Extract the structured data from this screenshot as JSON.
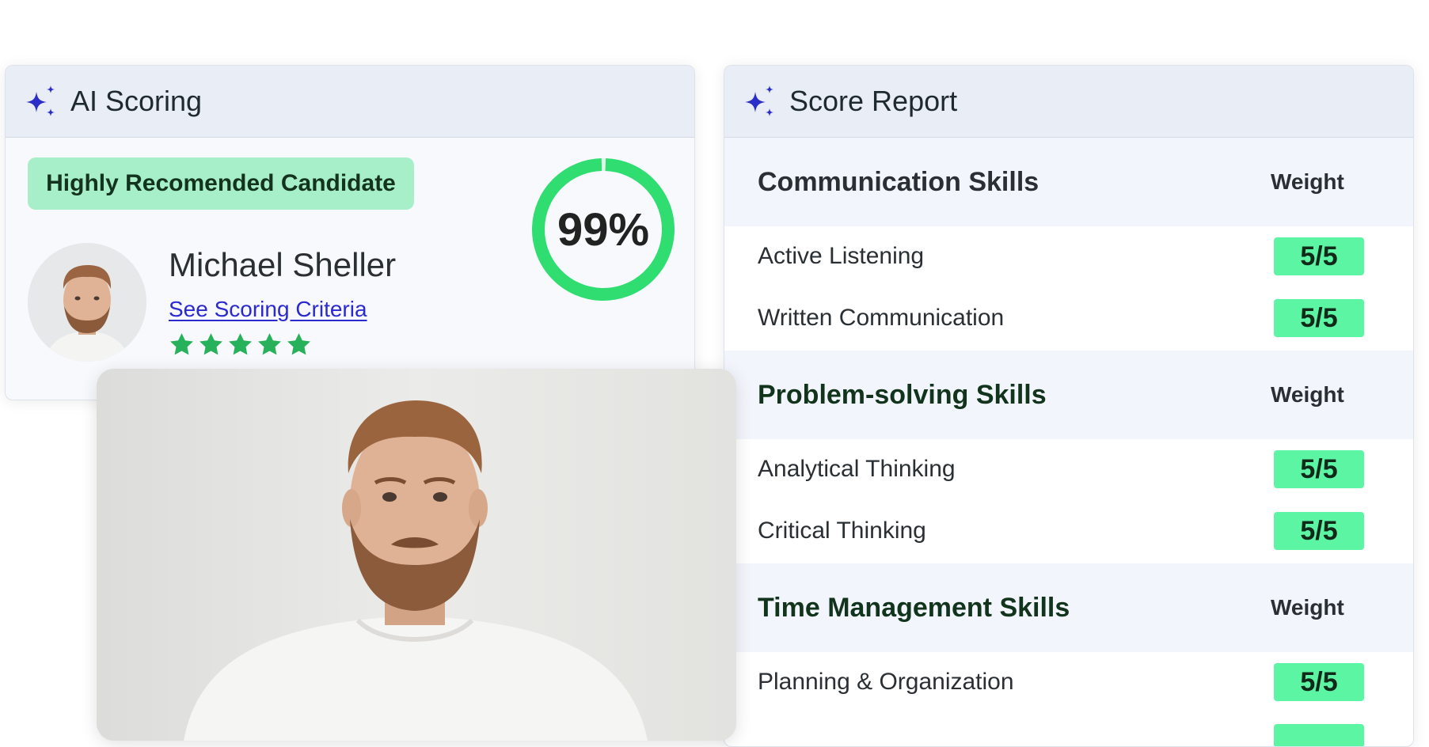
{
  "ai_scoring": {
    "title": "AI Scoring",
    "badge": "Highly Recomended Candidate",
    "candidate_name": "Michael Sheller",
    "criteria_link": "See Scoring Criteria",
    "score": "99%",
    "score_fraction": 0.99,
    "rating_stars": 5,
    "accent_color": "#2fdd71"
  },
  "score_report": {
    "title": "Score Report",
    "sections": [
      {
        "title": "Communication Skills",
        "weight_label": "Weight",
        "items": [
          {
            "label": "Active Listening",
            "score": "5/5"
          },
          {
            "label": "Written Communication",
            "score": "5/5"
          }
        ]
      },
      {
        "title": "Problem-solving Skills",
        "weight_label": "Weight",
        "items": [
          {
            "label": "Analytical Thinking",
            "score": "5/5"
          },
          {
            "label": "Critical Thinking",
            "score": "5/5"
          }
        ]
      },
      {
        "title": "Time Management Skills",
        "weight_label": "Weight",
        "items": [
          {
            "label": "Planning & Organization",
            "score": "5/5"
          }
        ]
      }
    ]
  },
  "colors": {
    "sparkle": "#2c2ec8",
    "badge_bg": "#a6efc8",
    "score_chip": "#5cf5a4",
    "link": "#2a2ad0",
    "star": "#27b15b"
  },
  "icons": [
    "sparkle-icon",
    "star-icon"
  ]
}
